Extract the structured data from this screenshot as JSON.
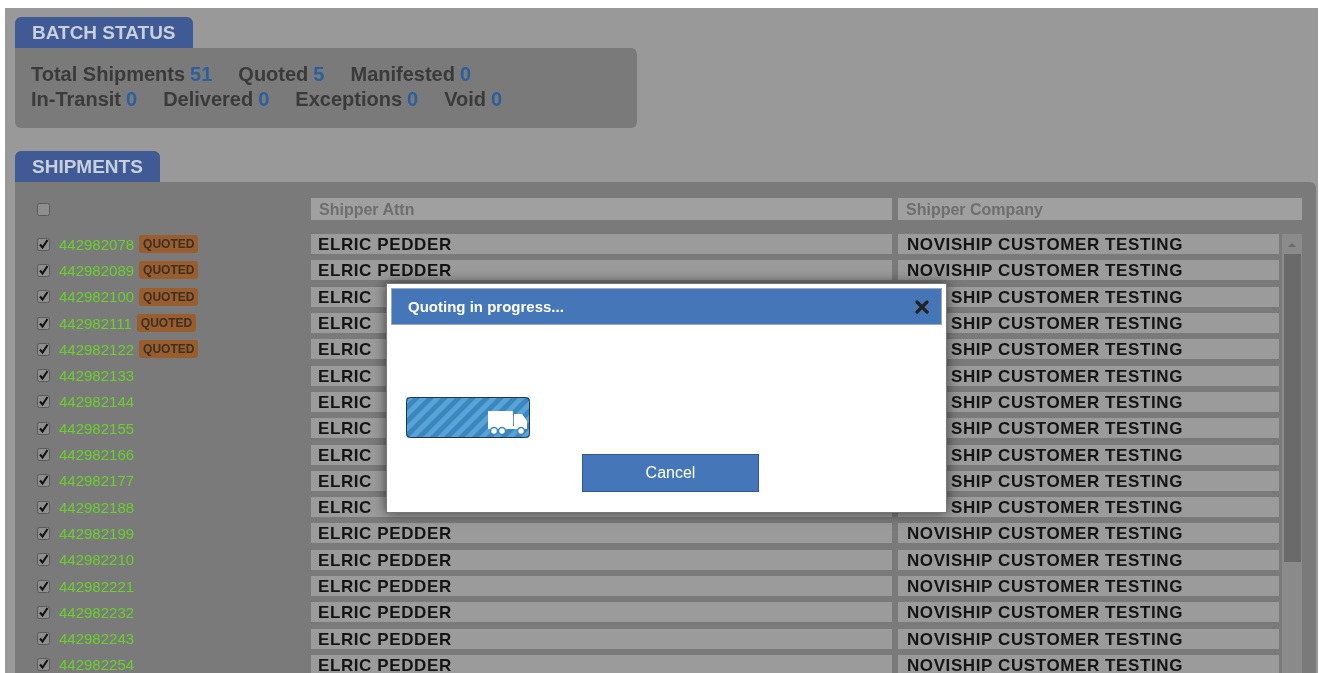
{
  "batch_status": {
    "title": "BATCH STATUS",
    "lines": [
      [
        {
          "label": "Total Shipments",
          "value": "51"
        },
        {
          "label": "Quoted",
          "value": "5"
        },
        {
          "label": "Manifested",
          "value": "0"
        }
      ],
      [
        {
          "label": "In-Transit",
          "value": "0"
        },
        {
          "label": "Delivered",
          "value": "0"
        },
        {
          "label": "Exceptions",
          "value": "0"
        },
        {
          "label": "Void",
          "value": "0"
        }
      ]
    ]
  },
  "shipments": {
    "title": "SHIPMENTS",
    "select_all": {
      "checked": false
    },
    "columns": [
      "Shipper Attn",
      "Shipper Company"
    ],
    "rows": [
      {
        "id": "442982078",
        "checked": true,
        "badge": "QUOTED",
        "attn": "ELRIC PEDDER",
        "company": "NOVISHIP CUSTOMER TESTING"
      },
      {
        "id": "442982089",
        "checked": true,
        "badge": "QUOTED",
        "attn": "ELRIC PEDDER",
        "company": "NOVISHIP CUSTOMER TESTING"
      },
      {
        "id": "442982100",
        "checked": true,
        "badge": "QUOTED",
        "attn": "ELRIC",
        "company": "SHIP CUSTOMER TESTING"
      },
      {
        "id": "442982111",
        "checked": true,
        "badge": "QUOTED",
        "attn": "ELRIC",
        "company": "SHIP CUSTOMER TESTING"
      },
      {
        "id": "442982122",
        "checked": true,
        "badge": "QUOTED",
        "attn": "ELRIC",
        "company": "SHIP CUSTOMER TESTING"
      },
      {
        "id": "442982133",
        "checked": true,
        "attn": "ELRIC",
        "company": "SHIP CUSTOMER TESTING"
      },
      {
        "id": "442982144",
        "checked": true,
        "attn": "ELRIC",
        "company": "SHIP CUSTOMER TESTING"
      },
      {
        "id": "442982155",
        "checked": true,
        "attn": "ELRIC",
        "company": "SHIP CUSTOMER TESTING"
      },
      {
        "id": "442982166",
        "checked": true,
        "attn": "ELRIC",
        "company": "SHIP CUSTOMER TESTING"
      },
      {
        "id": "442982177",
        "checked": true,
        "attn": "ELRIC",
        "company": "SHIP CUSTOMER TESTING"
      },
      {
        "id": "442982188",
        "checked": true,
        "attn": "ELRIC",
        "company": "SHIP CUSTOMER TESTING"
      },
      {
        "id": "442982199",
        "checked": true,
        "attn": "ELRIC PEDDER",
        "company": "NOVISHIP CUSTOMER TESTING"
      },
      {
        "id": "442982210",
        "checked": true,
        "attn": "ELRIC PEDDER",
        "company": "NOVISHIP CUSTOMER TESTING"
      },
      {
        "id": "442982221",
        "checked": true,
        "attn": "ELRIC PEDDER",
        "company": "NOVISHIP CUSTOMER TESTING"
      },
      {
        "id": "442982232",
        "checked": true,
        "attn": "ELRIC PEDDER",
        "company": "NOVISHIP CUSTOMER TESTING"
      },
      {
        "id": "442982243",
        "checked": true,
        "attn": "ELRIC PEDDER",
        "company": "NOVISHIP CUSTOMER TESTING"
      },
      {
        "id": "442982254",
        "checked": true,
        "attn": "ELRIC PEDDER",
        "company": "NOVISHIP CUSTOMER TESTING"
      }
    ]
  },
  "dialog": {
    "title": "Quoting in progress...",
    "cancel": "Cancel"
  }
}
